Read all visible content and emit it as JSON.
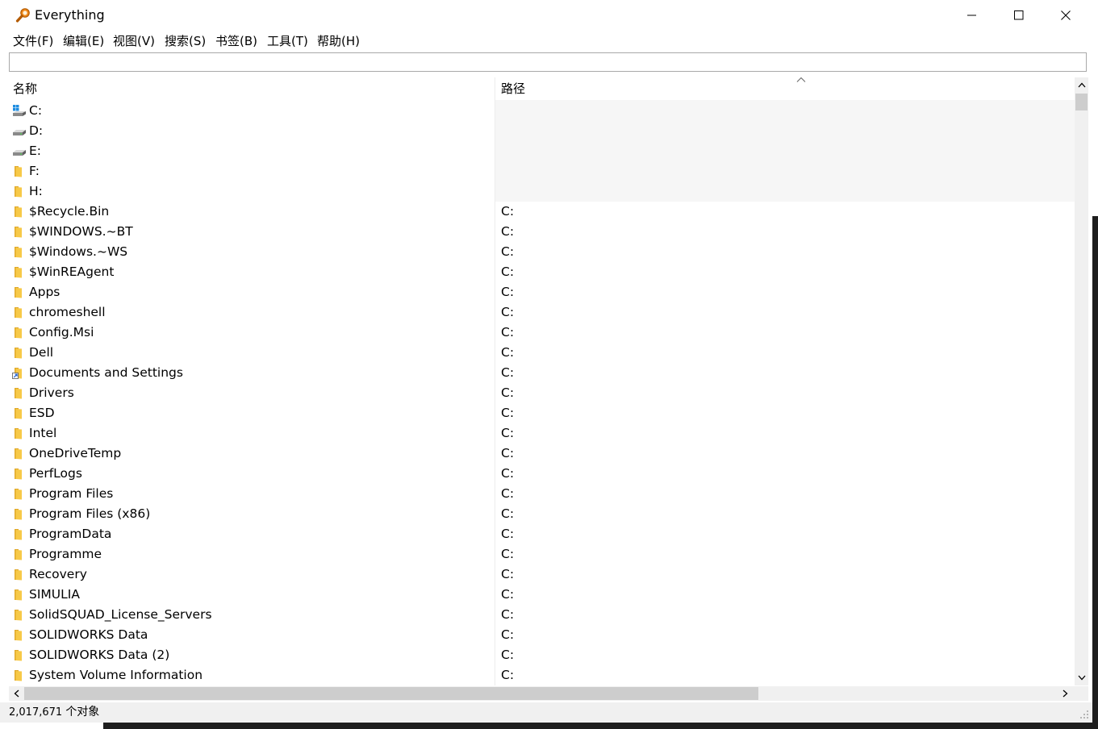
{
  "window": {
    "title": "Everything"
  },
  "menu": [
    {
      "label": "文件(F)"
    },
    {
      "label": "编辑(E)"
    },
    {
      "label": "视图(V)"
    },
    {
      "label": "搜索(S)"
    },
    {
      "label": "书签(B)"
    },
    {
      "label": "工具(T)"
    },
    {
      "label": "帮助(H)"
    }
  ],
  "search": {
    "value": "",
    "placeholder": ""
  },
  "columns": {
    "name": "名称",
    "path": "路径",
    "sort_column": "路径",
    "sort_direction": "ascending"
  },
  "files": [
    {
      "name": "C:",
      "path": "",
      "icon": "windows-drive-icon"
    },
    {
      "name": "D:",
      "path": "",
      "icon": "drive-icon"
    },
    {
      "name": "E:",
      "path": "",
      "icon": "drive-icon"
    },
    {
      "name": "F:",
      "path": "",
      "icon": "folder-icon"
    },
    {
      "name": "H:",
      "path": "",
      "icon": "folder-icon"
    },
    {
      "name": "$Recycle.Bin",
      "path": "C:",
      "icon": "folder-icon"
    },
    {
      "name": "$WINDOWS.~BT",
      "path": "C:",
      "icon": "folder-icon"
    },
    {
      "name": "$Windows.~WS",
      "path": "C:",
      "icon": "folder-icon"
    },
    {
      "name": "$WinREAgent",
      "path": "C:",
      "icon": "folder-icon"
    },
    {
      "name": "Apps",
      "path": "C:",
      "icon": "folder-icon"
    },
    {
      "name": "chromeshell",
      "path": "C:",
      "icon": "folder-icon"
    },
    {
      "name": "Config.Msi",
      "path": "C:",
      "icon": "folder-icon"
    },
    {
      "name": "Dell",
      "path": "C:",
      "icon": "folder-icon"
    },
    {
      "name": "Documents and Settings",
      "path": "C:",
      "icon": "folder-shortcut-icon"
    },
    {
      "name": "Drivers",
      "path": "C:",
      "icon": "folder-icon"
    },
    {
      "name": "ESD",
      "path": "C:",
      "icon": "folder-icon"
    },
    {
      "name": "Intel",
      "path": "C:",
      "icon": "folder-icon"
    },
    {
      "name": "OneDriveTemp",
      "path": "C:",
      "icon": "folder-icon"
    },
    {
      "name": "PerfLogs",
      "path": "C:",
      "icon": "folder-icon"
    },
    {
      "name": "Program Files",
      "path": "C:",
      "icon": "folder-icon"
    },
    {
      "name": "Program Files (x86)",
      "path": "C:",
      "icon": "folder-icon"
    },
    {
      "name": "ProgramData",
      "path": "C:",
      "icon": "folder-icon"
    },
    {
      "name": "Programme",
      "path": "C:",
      "icon": "folder-icon"
    },
    {
      "name": "Recovery",
      "path": "C:",
      "icon": "folder-icon"
    },
    {
      "name": "SIMULIA",
      "path": "C:",
      "icon": "folder-icon"
    },
    {
      "name": "SolidSQUAD_License_Servers",
      "path": "C:",
      "icon": "folder-icon"
    },
    {
      "name": "SOLIDWORKS Data",
      "path": "C:",
      "icon": "folder-icon"
    },
    {
      "name": "SOLIDWORKS Data (2)",
      "path": "C:",
      "icon": "folder-icon"
    },
    {
      "name": "System Volume Information",
      "path": "C:",
      "icon": "folder-icon"
    }
  ],
  "status": {
    "count": "2,017,671",
    "unit": "个对象"
  },
  "colors": {
    "folder": "#f7c948",
    "folder_dark": "#e0a92b",
    "scroll_thumb": "#cdcdcd",
    "status_bg": "#f0f0f0"
  }
}
